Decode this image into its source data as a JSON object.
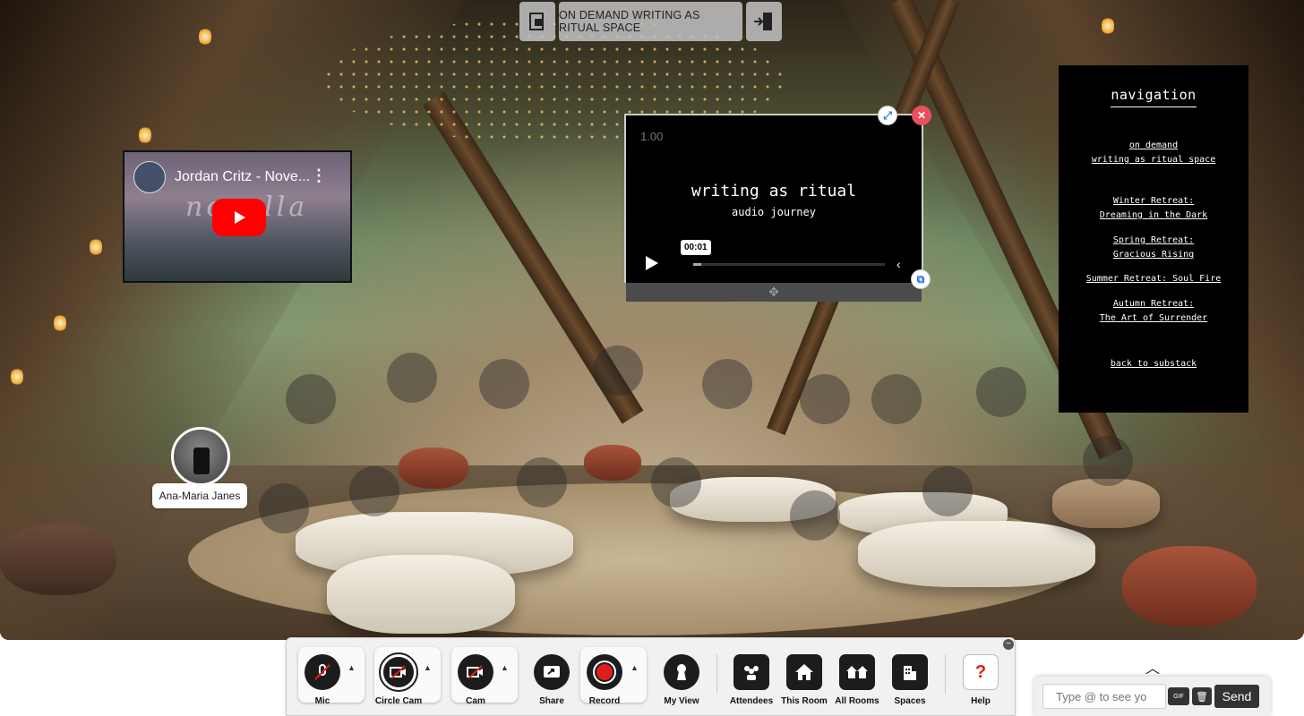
{
  "room": {
    "title": "ON DEMAND WRITING AS RITUAL SPACE",
    "lock_icon": "lock-icon",
    "exit_icon": "exit-door-icon"
  },
  "youtube": {
    "title": "Jordan Critz - Nove...",
    "watermark": "novella",
    "more_icon": "more-vert-icon",
    "play_icon": "youtube-play-icon"
  },
  "audio_player": {
    "speed": "1.00",
    "title": "writing as ritual",
    "subtitle": "audio journey",
    "time_tooltip": "00:01",
    "progress": 0.04
  },
  "navigation": {
    "heading": "navigation",
    "links": [
      "on demand \nwriting as ritual space",
      "Winter Retreat:\nDreaming in the Dark",
      "Spring Retreat:\nGracious Rising",
      "Summer Retreat: Soul Fire",
      "Autumn Retreat:\nThe Art of Surrender",
      "back to substack"
    ]
  },
  "participant": {
    "name": "Ana-Maria Janes"
  },
  "toolbar": {
    "mic": "Mic",
    "circle_cam": "Circle Cam",
    "cam": "Cam",
    "share": "Share",
    "record": "Record",
    "my_view": "My View",
    "attendees": "Attendees",
    "this_room": "This Room",
    "all_rooms": "All Rooms",
    "spaces": "Spaces",
    "help": "Help",
    "help_glyph": "?"
  },
  "chat": {
    "placeholder": "Type @ to see yo",
    "gif": "GIF",
    "send": "Send"
  },
  "colors": {
    "record_red": "#e01d1d",
    "close_red": "#e9505d",
    "accent_blue": "#1b72e8"
  }
}
